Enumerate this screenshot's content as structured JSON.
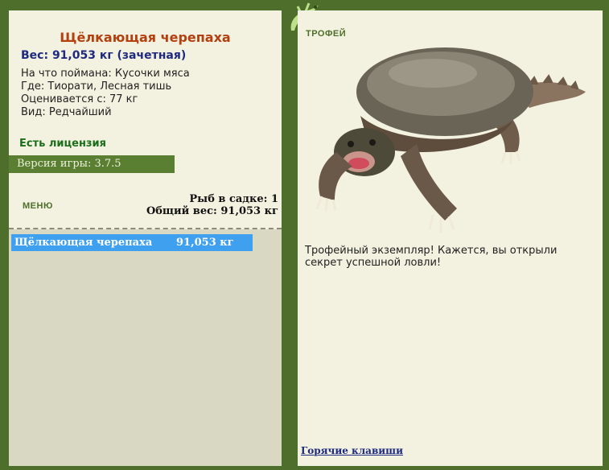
{
  "fish": {
    "name": "Щёлкающая черепаха",
    "weight_line": "Вес: 91,053 кг (зачетная)",
    "bait": "На что поймана: Кусочки мяса",
    "location": "Где: Тиорати, Лесная тишь",
    "rated_from": "Оценивается с: 77 кг",
    "kind": "Вид: Редчайший"
  },
  "license": "Есть лицензия",
  "version": "Версия игры: 3.7.5",
  "menu_label": "МЕНЮ",
  "keepnet": {
    "count_line": "Рыб в садке: 1",
    "total_line": "Общий вес: 91,053 кг"
  },
  "catch_list": [
    {
      "name": "Щёлкающая черепаха",
      "weight": "91,053 кг"
    }
  ],
  "trophy": {
    "label": "ТРОФЕЙ",
    "description": "Трофейный экземпляр! Кажется, вы открыли секрет успешной ловли!"
  },
  "hotkeys_link": "Горячие клавиши",
  "colors": {
    "frame": "#4d6f2b",
    "panel": "#f3f1df",
    "highlight": "#3fa0f0",
    "title": "#b3400e"
  }
}
